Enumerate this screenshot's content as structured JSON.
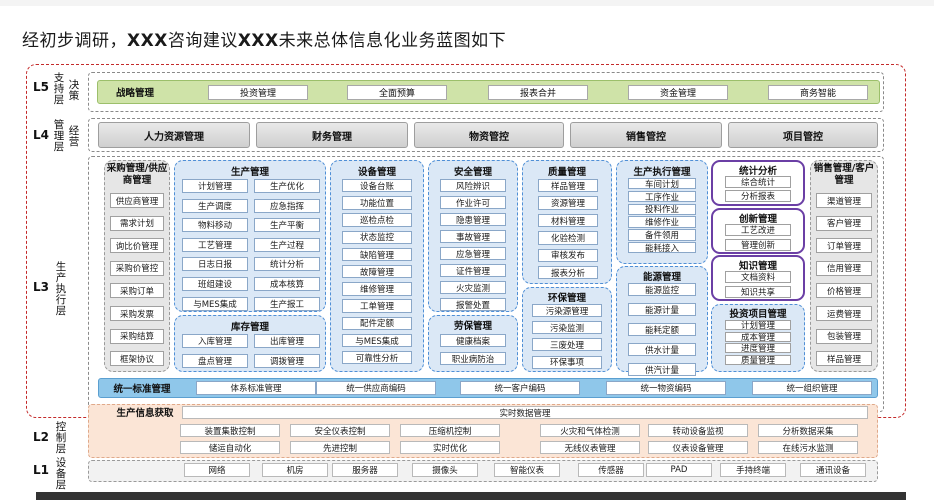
{
  "title": {
    "prefix": "经初步调研，",
    "b1": "XXX",
    "mid": "咨询建议",
    "b2": "XXX",
    "suffix": "未来总体信息化业务蓝图如下"
  },
  "layers": {
    "l5": {
      "tag": "L5",
      "label": "支持层",
      "sub": "决策",
      "bar_title": "战略管理",
      "items": [
        "投资管理",
        "全面预算",
        "报表合并",
        "资金管理",
        "商务智能"
      ]
    },
    "l4": {
      "tag": "L4",
      "label": "管理层",
      "sub": "经营",
      "items": [
        "人力资源管理",
        "财务管理",
        "物资管控",
        "销售管控",
        "项目管控"
      ]
    },
    "l3": {
      "tag": "L3",
      "label": "生产执行层"
    },
    "l2": {
      "tag": "L2",
      "label": "控制层",
      "header": "生产信息获取",
      "realtime": "实时数据管理",
      "row1": [
        "装置集散控制",
        "安全仪表控制",
        "压缩机控制",
        "火灾和气体检测",
        "转动设备监视",
        "分析数据采集"
      ],
      "row2": [
        "储运自动化",
        "先进控制",
        "实时优化",
        "无线仪表管理",
        "仪表设备管理",
        "在线污水监测"
      ]
    },
    "l1": {
      "tag": "L1",
      "label": "设备层",
      "items": [
        "网络",
        "机房",
        "服务器",
        "摄像头",
        "智能仪表",
        "传感器",
        "PAD",
        "手持终端",
        "通讯设备"
      ]
    }
  },
  "panels": {
    "purchase": {
      "title": "采购管理/供应商管理",
      "items": [
        "供应商管理",
        "需求计划",
        "询比价管理",
        "采购价管控",
        "采购订单",
        "采购发票",
        "采购结算",
        "框架协议"
      ]
    },
    "production": {
      "title": "生产管理",
      "items": [
        "计划管理",
        "生产优化",
        "生产调度",
        "应急指挥",
        "物料移动",
        "生产平衡",
        "工艺管理",
        "生产过程",
        "日志日报",
        "统计分析",
        "班组建设",
        "成本核算",
        "与MES集成",
        "生产报工"
      ]
    },
    "inventory": {
      "title": "库存管理",
      "items": [
        "入库管理",
        "出库管理",
        "盘点管理",
        "调拨管理"
      ]
    },
    "equipment": {
      "title": "设备管理",
      "items": [
        "设备台账",
        "功能位置",
        "巡检点检",
        "状态监控",
        "缺陷管理",
        "故障管理",
        "维修管理",
        "工单管理",
        "配件定额",
        "与MES集成",
        "可靠性分析"
      ]
    },
    "safety": {
      "title": "安全管理",
      "items": [
        "风险辨识",
        "作业许可",
        "隐患管理",
        "事故管理",
        "应急管理",
        "证件管理",
        "火灾监测",
        "报警处置"
      ]
    },
    "labor": {
      "title": "劳保管理",
      "items": [
        "健康档案",
        "职业病防治"
      ]
    },
    "quality": {
      "title": "质量管理",
      "items": [
        "样品管理",
        "资源管理",
        "材料管理",
        "化验检测",
        "审核发布",
        "报表分析"
      ]
    },
    "environment": {
      "title": "环保管理",
      "items": [
        "污染源管理",
        "污染监测",
        "三废处理",
        "环保事项"
      ]
    },
    "execution": {
      "title": "生产执行管理",
      "items": [
        "车间计划",
        "工序作业",
        "投料作业",
        "维修作业",
        "备件领用",
        "能耗接入"
      ]
    },
    "energy": {
      "title": "能源管理",
      "items": [
        "能源监控",
        "能源计量",
        "能耗定额",
        "供水计量",
        "供汽计量"
      ]
    },
    "stats": {
      "title": "统计分析",
      "items": [
        "综合统计",
        "分析报表"
      ]
    },
    "innovation": {
      "title": "创新管理",
      "items": [
        "工艺改进",
        "管理创新"
      ]
    },
    "knowledge": {
      "title": "知识管理",
      "items": [
        "文档资料",
        "知识共享"
      ]
    },
    "project": {
      "title": "投资项目管理",
      "items": [
        "计划管理",
        "成本管理",
        "进度管理",
        "质量管理"
      ]
    },
    "sales": {
      "title": "销售管理/客户管理",
      "items": [
        "渠道管理",
        "客户管理",
        "订单管理",
        "信用管理",
        "价格管理",
        "运费管理",
        "包装管理",
        "样品管理"
      ]
    }
  },
  "unify": {
    "title": "统一标准管理",
    "items": [
      "体系标准管理",
      "统一供应商编码",
      "统一客户编码",
      "统一物资编码",
      "统一组织管理"
    ]
  },
  "colors": {
    "red_dash": "#c42a2a",
    "green_bar": "#cfe3a8",
    "blue_panel": "#dbe8f6",
    "blue_dash": "#4f8fd6",
    "purple": "#6b3fa5",
    "peach": "#fbe5d6",
    "unify_blue": "#8fc7ea"
  }
}
